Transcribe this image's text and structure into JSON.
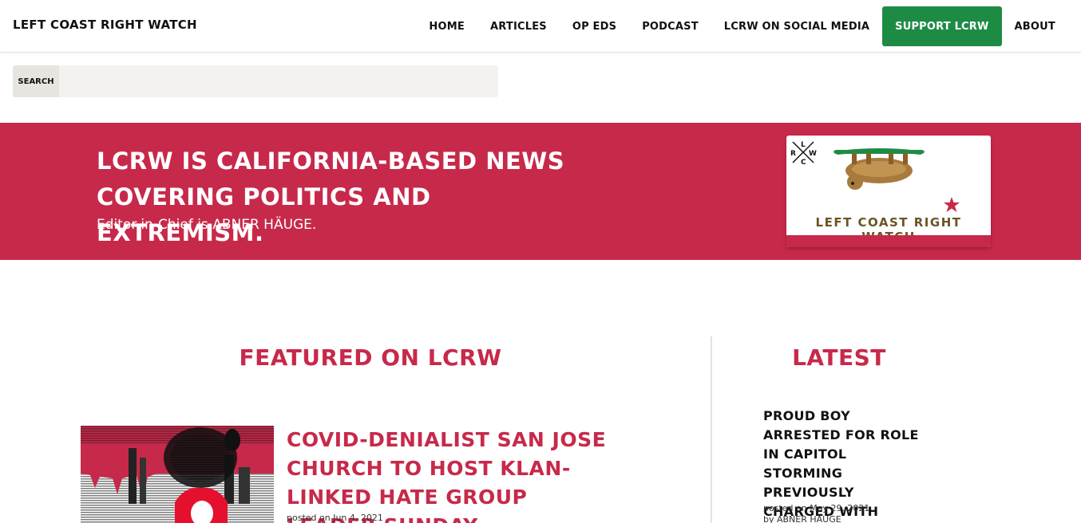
{
  "header": {
    "brand": "LEFT COAST RIGHT WATCH",
    "nav": {
      "home": "HOME",
      "articles": "ARTICLES",
      "op_eds": "OP EDS",
      "podcast": "PODCAST",
      "social": "LCRW ON SOCIAL MEDIA",
      "support": "SUPPORT LCRW",
      "about": "ABOUT"
    }
  },
  "search": {
    "label": "SEARCH",
    "value": "",
    "placeholder": ""
  },
  "hero": {
    "title": "LCRW IS CALIFORNIA-BASED NEWS COVERING POLITICS AND EXTREMISM.",
    "subtitle": "Editor-in-Chief is ABNER HÄUGE.",
    "logo_text": "LEFT COAST RIGHT WATCH",
    "logo_mark": [
      "L",
      "R",
      "W",
      "C"
    ]
  },
  "featured": {
    "heading": "FEATURED ON LCRW",
    "article": {
      "title": "COVID-DENIALIST SAN JOSE CHURCH TO HOST KLAN-LINKED HATE GROUP LEADER SUNDAY",
      "meta": "posted on Jun 4, 2021"
    }
  },
  "latest": {
    "heading": "LATEST",
    "article": {
      "title": "PROUD BOY ARRESTED FOR ROLE IN CAPITOL STORMING PREVIOUSLY CHARGED WITH RAPING MINOR",
      "meta": "posted on May 29, 2021",
      "byline": "by ABNER HÄUGE"
    }
  },
  "colors": {
    "accent_red": "#c7294a",
    "support_green": "#1e8b45"
  }
}
